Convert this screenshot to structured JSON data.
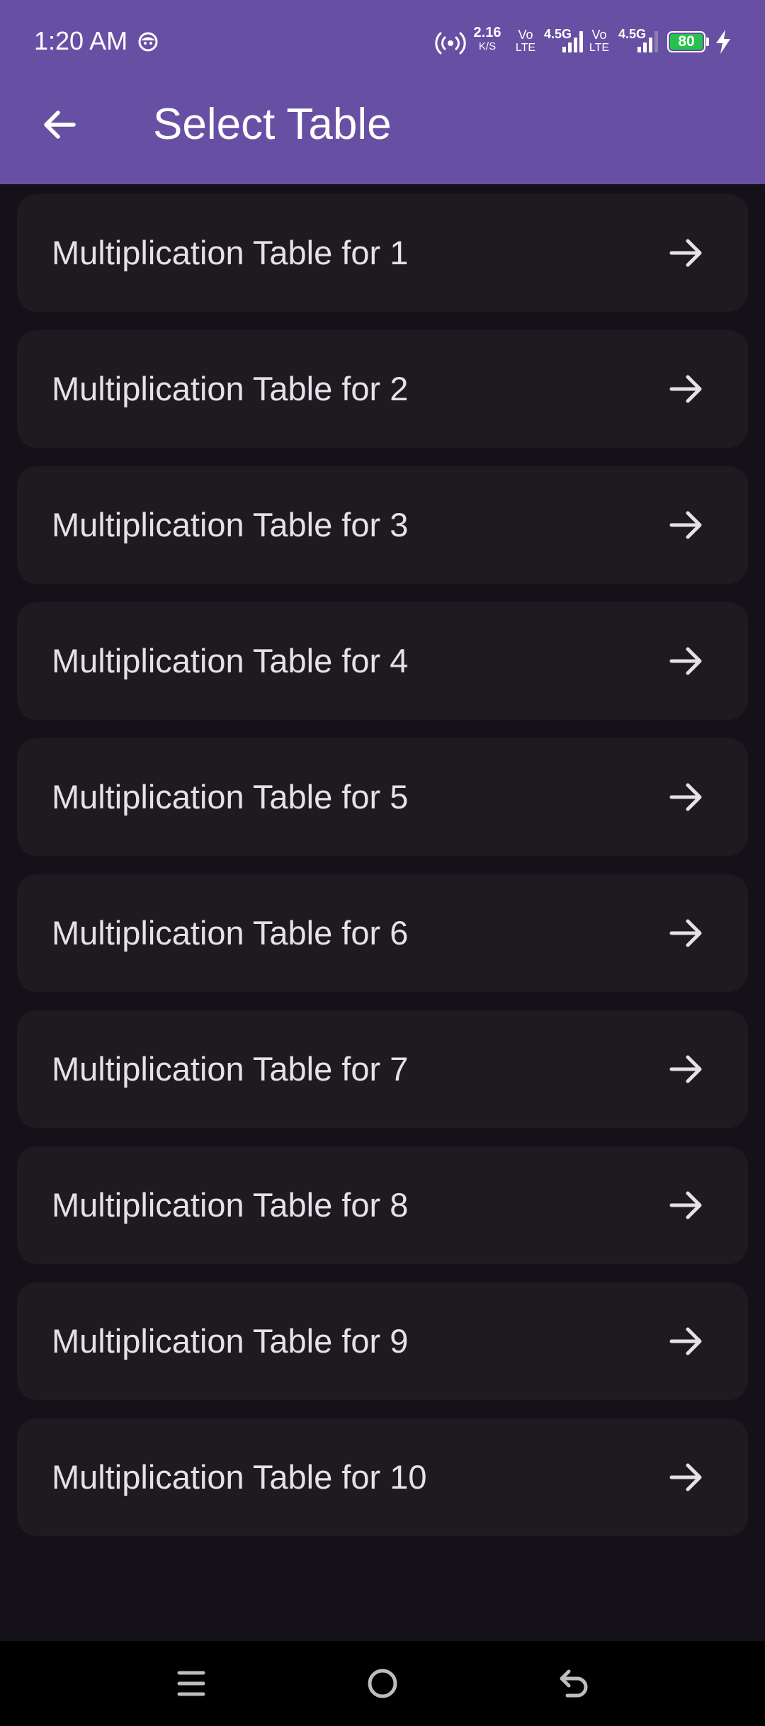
{
  "status_bar": {
    "time": "1:20 AM",
    "speed_value": "2.16",
    "speed_unit": "K/S",
    "sim1": {
      "volte_top": "Vo",
      "volte_bottom": "LTE",
      "network": "4.5G"
    },
    "sim2": {
      "volte_top": "Vo",
      "volte_bottom": "LTE",
      "network": "4.5G"
    },
    "battery_level": "80",
    "icons": [
      "face-icon",
      "hotspot-icon",
      "signal-icon",
      "battery-icon",
      "charging-icon"
    ]
  },
  "app_bar": {
    "title": "Select Table",
    "background_color": "#6750A4",
    "back_icon": "arrow-left-icon"
  },
  "tables": [
    {
      "label": "Multiplication Table for 1",
      "icon": "arrow-right-icon"
    },
    {
      "label": "Multiplication Table for 2",
      "icon": "arrow-right-icon"
    },
    {
      "label": "Multiplication Table for 3",
      "icon": "arrow-right-icon"
    },
    {
      "label": "Multiplication Table for 4",
      "icon": "arrow-right-icon"
    },
    {
      "label": "Multiplication Table for 5",
      "icon": "arrow-right-icon"
    },
    {
      "label": "Multiplication Table for 6",
      "icon": "arrow-right-icon"
    },
    {
      "label": "Multiplication Table for 7",
      "icon": "arrow-right-icon"
    },
    {
      "label": "Multiplication Table for 8",
      "icon": "arrow-right-icon"
    },
    {
      "label": "Multiplication Table for 9",
      "icon": "arrow-right-icon"
    },
    {
      "label": "Multiplication Table for 10",
      "icon": "arrow-right-icon"
    }
  ],
  "colors": {
    "background": "#141218",
    "card": "#1D1B20",
    "card_text": "#E6E0E9",
    "battery": "#27C24C"
  },
  "nav_bar": {
    "icons": [
      "recent-apps-icon",
      "home-icon",
      "back-icon"
    ]
  }
}
